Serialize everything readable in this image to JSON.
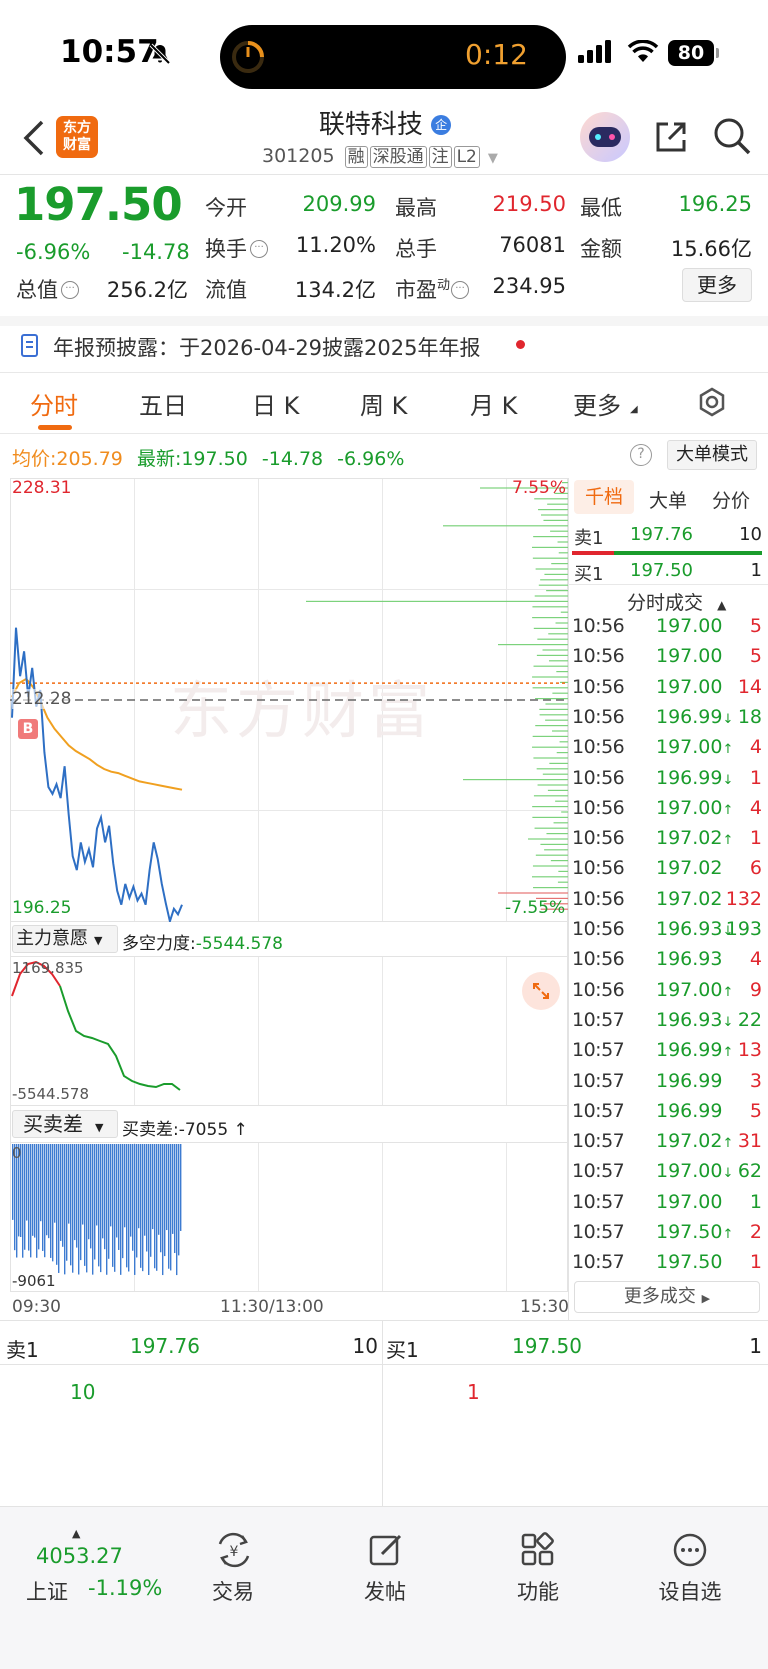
{
  "status_bar": {
    "time": "10:57",
    "timer": "0:12",
    "battery": "80"
  },
  "header": {
    "stock_name": "联特科技",
    "badge": "企",
    "code": "301205",
    "tags": [
      "融",
      "深股通",
      "注",
      "L2"
    ],
    "logo_line1": "东方",
    "logo_line2": "财富"
  },
  "quote": {
    "price": "197.50",
    "change_pct": "-6.96%",
    "change": "-14.78",
    "open_label": "今开",
    "open": "209.99",
    "high_label": "最高",
    "high": "219.50",
    "low_label": "最低",
    "low": "196.25",
    "turnover_label": "换手",
    "turnover": "11.20%",
    "volume_label": "总手",
    "volume": "76081",
    "amount_label": "金额",
    "amount": "15.66亿",
    "mktcap_label": "总值",
    "mktcap": "256.2亿",
    "float_label": "流值",
    "float": "134.2亿",
    "pe_label": "市盈",
    "pe_sup": "动",
    "pe": "234.95",
    "more_label": "更多"
  },
  "notice": {
    "text": "年报预披露：于2026-04-29披露2025年年报"
  },
  "tabs": [
    "分时",
    "五日",
    "日 K",
    "周 K",
    "月 K",
    "更多"
  ],
  "chart_info": {
    "avg_label": "均价:",
    "avg": "205.79",
    "latest_label": "最新:",
    "latest": "197.50",
    "latest_change": "-14.78",
    "latest_pct": "-6.96%",
    "big_order_mode": "大单模式"
  },
  "chart_data": {
    "type": "line",
    "x": [
      "09:30",
      "11:30/13:00",
      "15:30"
    ],
    "y_max": "228.31",
    "y_ref": "212.28",
    "y_min": "196.25",
    "pct_max": "7.55%",
    "pct_min": "-7.55%",
    "watermark": "东方财富",
    "buy_marker": "B",
    "series": [
      {
        "color": "#2e6fc4",
        "values": [
          211.0,
          217.5,
          214.0,
          215.8,
          212.5,
          214.6,
          211.8,
          213.0,
          208.5,
          206.0,
          205.5,
          206.2,
          205.2,
          207.5,
          204.0,
          201.0,
          200.0,
          202.0,
          200.6,
          201.5,
          200.2,
          203.0,
          203.8,
          202.0,
          203.2,
          200.5,
          198.5,
          197.5,
          199.0,
          198.0,
          198.8,
          197.8,
          198.3,
          197.5,
          200.0,
          202.0,
          200.8,
          199.0,
          197.6,
          196.3,
          197.2,
          196.8,
          197.5
        ]
      },
      {
        "color": "#f0a020",
        "values": [
          212.5,
          213.5,
          213.8,
          213.2,
          212.2,
          211.0,
          210.2,
          209.6,
          209.0,
          208.6,
          208.3,
          208.0,
          207.6,
          207.3,
          207.1,
          207.0,
          206.8,
          206.6,
          206.4,
          206.3,
          206.2,
          206.1,
          206.0,
          205.9,
          205.8
        ]
      }
    ]
  },
  "indicator1": {
    "name": "主力意愿",
    "label": "多空力度:",
    "value": "-5544.578",
    "max": "1169.835",
    "min": "-5544.578"
  },
  "indicator2": {
    "name": "买卖差",
    "label": "买卖差:",
    "value": "-7055",
    "arrow": "↑",
    "max": "0",
    "min": "-9061"
  },
  "side_panel": {
    "tabs": [
      "千档",
      "大单",
      "分价"
    ],
    "sell1": {
      "label": "卖1",
      "price": "197.76",
      "vol": "10"
    },
    "buy1": {
      "label": "买1",
      "price": "197.50",
      "vol": "1"
    },
    "trades_title": "分时成交",
    "trades": [
      {
        "t": "10:56",
        "p": "197.00",
        "a": "",
        "v": "5",
        "c": "green",
        "vc": "red"
      },
      {
        "t": "10:56",
        "p": "197.00",
        "a": "",
        "v": "5",
        "c": "green",
        "vc": "red"
      },
      {
        "t": "10:56",
        "p": "197.00",
        "a": "",
        "v": "14",
        "c": "green",
        "vc": "red"
      },
      {
        "t": "10:56",
        "p": "196.99",
        "a": "↓",
        "v": "18",
        "c": "green",
        "vc": "green"
      },
      {
        "t": "10:56",
        "p": "197.00",
        "a": "↑",
        "v": "4",
        "c": "green",
        "vc": "red"
      },
      {
        "t": "10:56",
        "p": "196.99",
        "a": "↓",
        "v": "1",
        "c": "green",
        "vc": "red"
      },
      {
        "t": "10:56",
        "p": "197.00",
        "a": "↑",
        "v": "4",
        "c": "green",
        "vc": "red"
      },
      {
        "t": "10:56",
        "p": "197.02",
        "a": "↑",
        "v": "1",
        "c": "green",
        "vc": "red"
      },
      {
        "t": "10:56",
        "p": "197.02",
        "a": "",
        "v": "6",
        "c": "green",
        "vc": "red"
      },
      {
        "t": "10:56",
        "p": "197.02",
        "a": "",
        "v": "132",
        "c": "green",
        "vc": "red"
      },
      {
        "t": "10:56",
        "p": "196.93",
        "a": "↓",
        "v": "193",
        "c": "green",
        "vc": "green"
      },
      {
        "t": "10:56",
        "p": "196.93",
        "a": "",
        "v": "4",
        "c": "green",
        "vc": "red"
      },
      {
        "t": "10:56",
        "p": "197.00",
        "a": "↑",
        "v": "9",
        "c": "green",
        "vc": "red"
      },
      {
        "t": "10:57",
        "p": "196.93",
        "a": "↓",
        "v": "22",
        "c": "green",
        "vc": "green"
      },
      {
        "t": "10:57",
        "p": "196.99",
        "a": "↑",
        "v": "13",
        "c": "green",
        "vc": "red"
      },
      {
        "t": "10:57",
        "p": "196.99",
        "a": "",
        "v": "3",
        "c": "green",
        "vc": "red"
      },
      {
        "t": "10:57",
        "p": "196.99",
        "a": "",
        "v": "5",
        "c": "green",
        "vc": "red"
      },
      {
        "t": "10:57",
        "p": "197.02",
        "a": "↑",
        "v": "31",
        "c": "green",
        "vc": "red"
      },
      {
        "t": "10:57",
        "p": "197.00",
        "a": "↓",
        "v": "62",
        "c": "green",
        "vc": "green"
      },
      {
        "t": "10:57",
        "p": "197.00",
        "a": "",
        "v": "1",
        "c": "green",
        "vc": "green"
      },
      {
        "t": "10:57",
        "p": "197.50",
        "a": "↑",
        "v": "2",
        "c": "green",
        "vc": "red"
      },
      {
        "t": "10:57",
        "p": "197.50",
        "a": "",
        "v": "1",
        "c": "green",
        "vc": "red"
      }
    ],
    "more_trades": "更多成交"
  },
  "orderbook": {
    "sell_label": "卖1",
    "sell_price": "197.76",
    "sell_vol": "10",
    "sell_detail": "10",
    "buy_label": "买1",
    "buy_price": "197.50",
    "buy_vol": "1",
    "buy_detail": "1"
  },
  "bottom_nav": {
    "index_value": "4053.27",
    "index_name": "上证",
    "index_pct": "-1.19%",
    "items": [
      "交易",
      "发帖",
      "功能",
      "设自选"
    ]
  }
}
